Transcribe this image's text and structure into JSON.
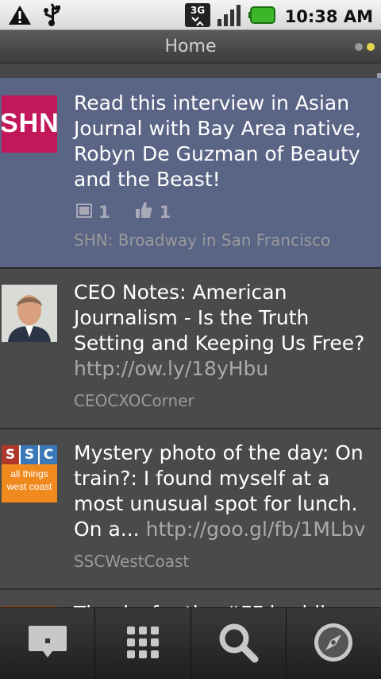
{
  "status": {
    "time": "10:38 AM",
    "network": "3G"
  },
  "header": {
    "title": "Home",
    "page_indicator_active": 2
  },
  "colors": {
    "accent_dot": "#e6d84a",
    "highlight_row": "#5a6485",
    "shn_brand": "#c2185b"
  },
  "feed": [
    {
      "text": "Read this interview in Asian Journal with Bay Area native, Robyn De Guzman of Beauty and the Beast!",
      "comments": "1",
      "likes": "1",
      "source": "SHN: Broadway in San Francisco",
      "avatar_text": "SHN"
    },
    {
      "text": "CEO Notes: American Journalism - Is the Truth Setting and Keeping Us Free?",
      "url": "http://ow.ly/18yHbu",
      "source": "CEOCXOCorner"
    },
    {
      "text": "Mystery photo of the day: On train?: I found myself at a most unusual spot for lunch. On a...",
      "url": "http://goo.gl/fb/1MLbv",
      "source": "SSCWestCoast",
      "avatar_letters": [
        "S",
        "S",
        "C"
      ],
      "avatar_sub": "all things west coast"
    },
    {
      "text": "Thanks for the #FF buddies"
    }
  ],
  "bottom_nav": [
    {
      "icon": "compose-icon"
    },
    {
      "icon": "grid-icon"
    },
    {
      "icon": "search-icon"
    },
    {
      "icon": "compass-icon"
    }
  ]
}
